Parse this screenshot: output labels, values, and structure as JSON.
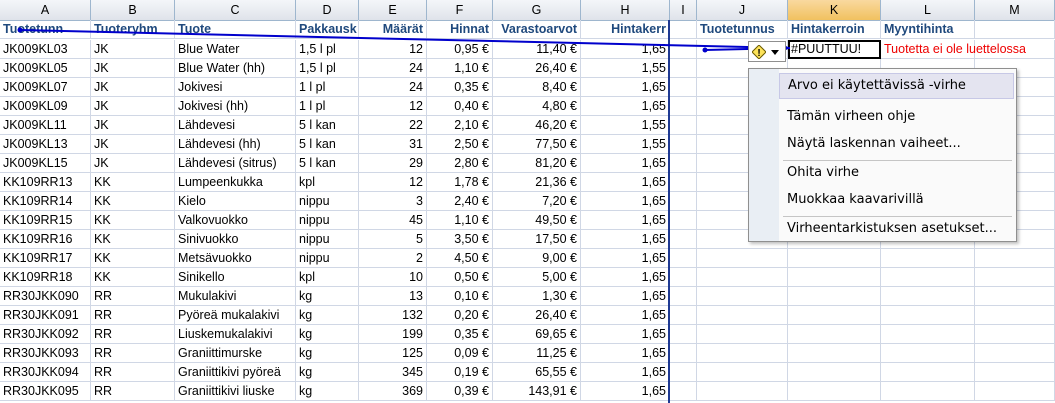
{
  "columns": [
    "A",
    "B",
    "C",
    "D",
    "E",
    "F",
    "G",
    "H",
    "I",
    "J",
    "K",
    "L",
    "M"
  ],
  "selected_column": "K",
  "header_row": [
    "Tuotetunn",
    "Tuoteryhm",
    "Tuote",
    "Pakkausk",
    "Määrät",
    "Hinnat",
    "Varastoarvot",
    "Hintakerr",
    "",
    "Tuotetunnus",
    "Hintakerroin",
    "Myyntihinta",
    ""
  ],
  "rows": [
    [
      "JK009KL03",
      "JK",
      "Blue Water",
      "1,5 l pl",
      "12",
      "0,95 €",
      "11,40 €",
      "1,65"
    ],
    [
      "JK009KL05",
      "JK",
      "Blue Water (hh)",
      "1,5 l pl",
      "24",
      "1,10 €",
      "26,40 €",
      "1,55"
    ],
    [
      "JK009KL07",
      "JK",
      "Jokivesi",
      "1 l pl",
      "24",
      "0,35 €",
      "8,40 €",
      "1,65"
    ],
    [
      "JK009KL09",
      "JK",
      "Jokivesi (hh)",
      "1 l pl",
      "12",
      "0,40 €",
      "4,80 €",
      "1,65"
    ],
    [
      "JK009KL11",
      "JK",
      "Lähdevesi",
      "5 l kan",
      "22",
      "2,10 €",
      "46,20 €",
      "1,55"
    ],
    [
      "JK009KL13",
      "JK",
      "Lähdevesi (hh)",
      "5 l kan",
      "31",
      "2,50 €",
      "77,50 €",
      "1,55"
    ],
    [
      "JK009KL15",
      "JK",
      "Lähdevesi (sitrus)",
      "5 l kan",
      "29",
      "2,80 €",
      "81,20 €",
      "1,65"
    ],
    [
      "KK109RR13",
      "KK",
      "Lumpeenkukka",
      "kpl",
      "12",
      "1,78 €",
      "21,36 €",
      "1,65"
    ],
    [
      "KK109RR14",
      "KK",
      "Kielo",
      "nippu",
      "3",
      "2,40 €",
      "7,20 €",
      "1,65"
    ],
    [
      "KK109RR15",
      "KK",
      "Valkovuokko",
      "nippu",
      "45",
      "1,10 €",
      "49,50 €",
      "1,65"
    ],
    [
      "KK109RR16",
      "KK",
      "Sinivuokko",
      "nippu",
      "5",
      "3,50 €",
      "17,50 €",
      "1,65"
    ],
    [
      "KK109RR17",
      "KK",
      "Metsävuokko",
      "nippu",
      "2",
      "4,50 €",
      "9,00 €",
      "1,65"
    ],
    [
      "KK109RR18",
      "KK",
      "Sinikello",
      "kpl",
      "10",
      "0,50 €",
      "5,00 €",
      "1,65"
    ],
    [
      "RR30JKK090",
      "RR",
      "Mukulakivi",
      "kg",
      "13",
      "0,10 €",
      "1,30 €",
      "1,65"
    ],
    [
      "RR30JKK091",
      "RR",
      "Pyöreä mukalakivi",
      "kg",
      "132",
      "0,20 €",
      "26,40 €",
      "1,65"
    ],
    [
      "RR30JKK092",
      "RR",
      "Liuskemukalakivi",
      "kg",
      "199",
      "0,35 €",
      "69,65 €",
      "1,65"
    ],
    [
      "RR30JKK093",
      "RR",
      "Graniittimurske",
      "kg",
      "125",
      "0,09 €",
      "11,25 €",
      "1,65"
    ],
    [
      "RR30JKK094",
      "RR",
      "Graniittikivi pyöreä",
      "kg",
      "345",
      "0,19 €",
      "65,55 €",
      "1,65"
    ],
    [
      "RR30JKK095",
      "RR",
      "Graniittikivi liuske",
      "kg",
      "369",
      "0,39 €",
      "143,91 €",
      "1,65"
    ]
  ],
  "error_cell": {
    "value": "#PUUTTUU!",
    "comment": "Tuotetta ei ole luettelossa"
  },
  "error_button": {
    "icon": "warning-diamond-icon",
    "arrow": "dropdown-arrow-icon"
  },
  "context_menu": {
    "items": [
      "Arvo ei käytettävissä -virhe",
      "Tämän virheen ohje",
      "Näytä laskennan vaiheet...",
      "Ohita virhe",
      "Muokkaa kaavarivillä",
      "Virheentarkistuksen asetukset..."
    ]
  },
  "colors": {
    "header_text": "#1f497d",
    "trace_line": "#0000cc",
    "error_text": "#e00000",
    "selected_header": "#f1c15f"
  }
}
